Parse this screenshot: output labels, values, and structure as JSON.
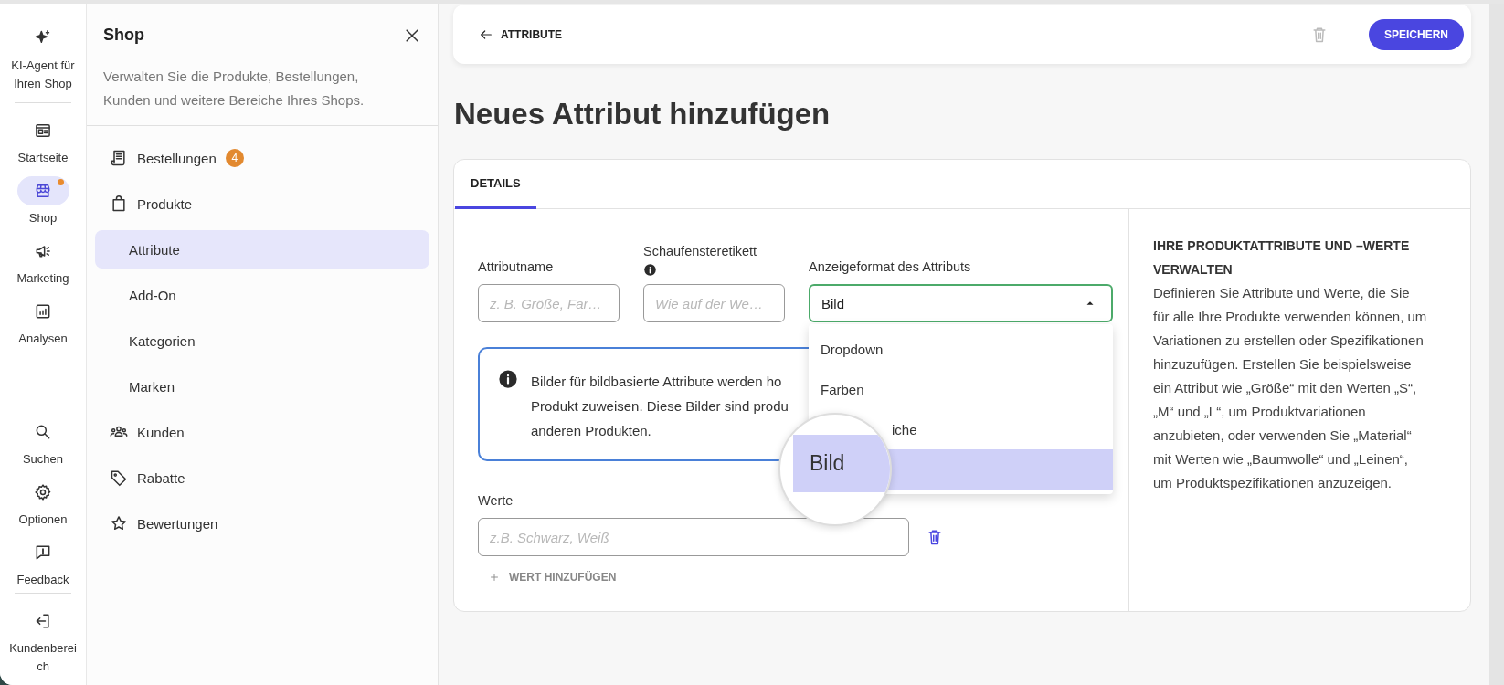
{
  "rail": {
    "header_item": {
      "label": "KI-Agent für Ihren Shop",
      "selected": false,
      "notification": false
    },
    "items": [
      {
        "label": "Startseite",
        "selected": false,
        "notification": false
      },
      {
        "label": "Shop",
        "selected": true,
        "notification": true
      },
      {
        "label": "Marketing",
        "selected": false,
        "notification": false
      },
      {
        "label": "Analysen",
        "selected": false,
        "notification": false
      }
    ],
    "footer_items": [
      {
        "label": "Suchen",
        "selected": false,
        "notification": false
      },
      {
        "label": "Optionen",
        "selected": false,
        "notification": false
      },
      {
        "label": "Feedback",
        "selected": false,
        "notification": false
      }
    ],
    "account_item": {
      "label": "Kundenbereich",
      "selected": false,
      "notification": false
    }
  },
  "sidebar": {
    "title": "Shop",
    "description": "Verwalten Sie die Produkte, Bestellungen, Kunden und weitere Bereiche Ihres Shops.",
    "items": [
      {
        "label": "Bestellungen",
        "selected": false,
        "badge": "4"
      },
      {
        "label": "Produkte",
        "selected": false,
        "children": [
          {
            "label": "Attribute",
            "selected": true
          },
          {
            "label": "Add-On",
            "selected": false
          },
          {
            "label": "Kategorien",
            "selected": false
          },
          {
            "label": "Marken",
            "selected": false
          }
        ]
      },
      {
        "label": "Kunden",
        "selected": false
      },
      {
        "label": "Rabatte",
        "selected": false
      },
      {
        "label": "Bewertungen",
        "selected": false
      }
    ]
  },
  "topbar": {
    "back_link": "ATTRIBUTE",
    "delete_button": {
      "disabled": true
    },
    "save_button": "SPEICHERN"
  },
  "page_title": "Neues Attribut hinzufügen",
  "tabs": [
    {
      "label": "DETAILS",
      "selected": true
    }
  ],
  "form": {
    "fields": [
      {
        "kind": "text",
        "label": "Attributname",
        "placeholder": "z. B. Größe, Far…",
        "info": false
      },
      {
        "kind": "text",
        "label": "Schaufensteretikett",
        "placeholder": "Wie auf der We…",
        "info": true
      },
      {
        "kind": "select",
        "label": "Anzeigeformat des Attributs",
        "value": "Bild",
        "expanded": true,
        "options": [
          {
            "label": "Dropdown",
            "selected": false
          },
          {
            "label": "Farben",
            "selected": false
          },
          {
            "label": "iche",
            "selected": false
          },
          {
            "label": "Bild",
            "selected": true
          }
        ]
      }
    ],
    "info_box": {
      "lines": [
        "Bilder für bildbasierte Attribute werden ho",
        "Produkt zuweisen. Diese Bilder sind produ",
        "anderen Produkten."
      ]
    },
    "values": {
      "label": "Werte",
      "placeholder": "z.B. Schwarz, Weiß"
    },
    "add_button": "WERT HINZUFÜGEN"
  },
  "help": {
    "title": "IHRE PRODUKTATTRIBUTE UND –WERTE VERWALTEN",
    "text": "Definieren Sie Attribute und Werte, die Sie für alle Ihre Produkte verwenden können, um Variationen zu erstellen oder Spezifikationen hinzuzufügen. Erstellen Sie beispielsweise ein Attribut wie „Größe“ mit den Werten „S“, „M“ und „L“, um Produktvariationen anzubieten, oder verwenden Sie „Material“ mit Werten wie „Baumwolle“ und „Leinen“, um Produktspezifikationen anzuzeigen."
  }
}
